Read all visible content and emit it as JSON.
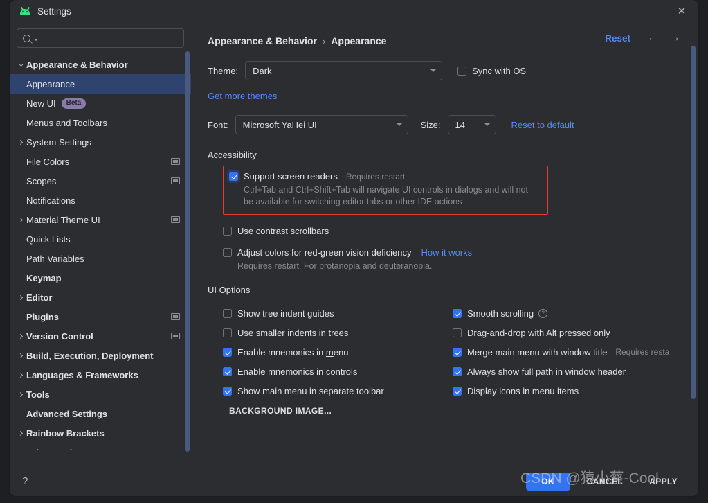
{
  "window": {
    "title": "Settings",
    "app_icon": "android-icon",
    "close_icon": "✕"
  },
  "sidebar": {
    "search": {
      "value": "",
      "placeholder": "",
      "icon": "search-icon"
    },
    "items": [
      {
        "label": "Appearance & Behavior",
        "level": 0,
        "bold": true,
        "arrow": "down",
        "selected": false,
        "badge": "",
        "scope_icon": false
      },
      {
        "label": "Appearance",
        "level": 1,
        "bold": false,
        "arrow": "none",
        "selected": true,
        "badge": "",
        "scope_icon": false
      },
      {
        "label": "New UI",
        "level": 1,
        "bold": false,
        "arrow": "none",
        "selected": false,
        "badge": "Beta",
        "scope_icon": false
      },
      {
        "label": "Menus and Toolbars",
        "level": 1,
        "bold": false,
        "arrow": "none",
        "selected": false,
        "badge": "",
        "scope_icon": false
      },
      {
        "label": "System Settings",
        "level": 1,
        "bold": false,
        "arrow": "right",
        "selected": false,
        "badge": "",
        "scope_icon": false
      },
      {
        "label": "File Colors",
        "level": 1,
        "bold": false,
        "arrow": "none",
        "selected": false,
        "badge": "",
        "scope_icon": true
      },
      {
        "label": "Scopes",
        "level": 1,
        "bold": false,
        "arrow": "none",
        "selected": false,
        "badge": "",
        "scope_icon": true
      },
      {
        "label": "Notifications",
        "level": 1,
        "bold": false,
        "arrow": "none",
        "selected": false,
        "badge": "",
        "scope_icon": false
      },
      {
        "label": "Material Theme UI",
        "level": 1,
        "bold": false,
        "arrow": "right",
        "selected": false,
        "badge": "",
        "scope_icon": true
      },
      {
        "label": "Quick Lists",
        "level": 1,
        "bold": false,
        "arrow": "none",
        "selected": false,
        "badge": "",
        "scope_icon": false
      },
      {
        "label": "Path Variables",
        "level": 1,
        "bold": false,
        "arrow": "none",
        "selected": false,
        "badge": "",
        "scope_icon": false
      },
      {
        "label": "Keymap",
        "level": 0,
        "bold": true,
        "arrow": "none",
        "selected": false,
        "badge": "",
        "scope_icon": false
      },
      {
        "label": "Editor",
        "level": 0,
        "bold": true,
        "arrow": "right",
        "selected": false,
        "badge": "",
        "scope_icon": false
      },
      {
        "label": "Plugins",
        "level": 0,
        "bold": true,
        "arrow": "none",
        "selected": false,
        "badge": "",
        "scope_icon": true
      },
      {
        "label": "Version Control",
        "level": 0,
        "bold": true,
        "arrow": "right",
        "selected": false,
        "badge": "",
        "scope_icon": true
      },
      {
        "label": "Build, Execution, Deployment",
        "level": 0,
        "bold": true,
        "arrow": "right",
        "selected": false,
        "badge": "",
        "scope_icon": false
      },
      {
        "label": "Languages & Frameworks",
        "level": 0,
        "bold": true,
        "arrow": "right",
        "selected": false,
        "badge": "",
        "scope_icon": false
      },
      {
        "label": "Tools",
        "level": 0,
        "bold": true,
        "arrow": "right",
        "selected": false,
        "badge": "",
        "scope_icon": false
      },
      {
        "label": "Advanced Settings",
        "level": 0,
        "bold": true,
        "arrow": "none",
        "selected": false,
        "badge": "",
        "scope_icon": false
      },
      {
        "label": "Rainbow Brackets",
        "level": 0,
        "bold": true,
        "arrow": "right",
        "selected": false,
        "badge": "",
        "scope_icon": false
      },
      {
        "label": "Other Settings",
        "level": 0,
        "bold": true,
        "arrow": "right",
        "selected": false,
        "badge": "",
        "scope_icon": false
      }
    ]
  },
  "header": {
    "breadcrumb_root": "Appearance & Behavior",
    "breadcrumb_sep": "›",
    "breadcrumb_leaf": "Appearance",
    "reset_label": "Reset",
    "back_icon": "←",
    "forward_icon": "→"
  },
  "theme_row": {
    "label": "Theme:",
    "value": "Dark",
    "sync_label": "Sync with OS",
    "sync_checked": false
  },
  "get_more_themes": "Get more themes",
  "font_row": {
    "font_label": "Font:",
    "font_value": "Microsoft YaHei UI",
    "size_label": "Size:",
    "size_value": "14",
    "reset_default": "Reset to default"
  },
  "accessibility": {
    "section_title": "Accessibility",
    "screen_readers": {
      "label": "Support screen readers",
      "note": "Requires restart",
      "checked": true,
      "description": "Ctrl+Tab and Ctrl+Shift+Tab will navigate UI controls in dialogs and will not be available for switching editor tabs or other IDE actions",
      "highlight_color": "#e8392e"
    },
    "contrast_scrollbars": {
      "label": "Use contrast scrollbars",
      "checked": false
    },
    "red_green": {
      "label": "Adjust colors for red-green vision deficiency",
      "link": "How it works",
      "checked": false,
      "sub": "Requires restart. For protanopia and deuteranopia."
    }
  },
  "ui_options": {
    "section_title": "UI Options",
    "left": [
      {
        "label": "Show tree indent guides",
        "checked": false,
        "mnemonic": ""
      },
      {
        "label": "Use smaller indents in trees",
        "checked": false,
        "mnemonic": ""
      },
      {
        "label": "Enable mnemonics in menu",
        "checked": true,
        "mnemonic": "m"
      },
      {
        "label": "Enable mnemonics in controls",
        "checked": true,
        "mnemonic": ""
      },
      {
        "label": "Show main menu in separate toolbar",
        "checked": true,
        "mnemonic": ""
      }
    ],
    "right": [
      {
        "label": "Smooth scrolling",
        "checked": true,
        "help": true,
        "note": ""
      },
      {
        "label": "Drag-and-drop with Alt pressed only",
        "checked": false,
        "help": false,
        "note": ""
      },
      {
        "label": "Merge main menu with window title",
        "checked": true,
        "help": false,
        "note": "Requires resta"
      },
      {
        "label": "Always show full path in window header",
        "checked": true,
        "help": false,
        "note": ""
      },
      {
        "label": "Display icons in menu items",
        "checked": true,
        "help": false,
        "note": ""
      }
    ],
    "background_image_button": "BACKGROUND IMAGE..."
  },
  "footer": {
    "help_icon": "?",
    "ok": "OK",
    "cancel": "CANCEL",
    "apply": "APPLY"
  },
  "watermark": "CSDN @猿小蔡-Cool",
  "colors": {
    "accent_blue": "#3574F0",
    "link_blue": "#548AF7",
    "selection_blue": "#2E436E",
    "highlight_red": "#E8392E",
    "badge_purple": "#8A7CA8",
    "panel_bg": "#2B2D30"
  }
}
